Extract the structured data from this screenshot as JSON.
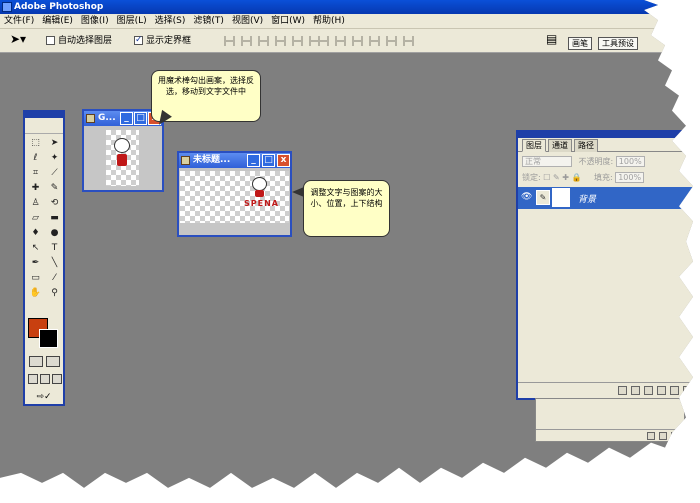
{
  "app": {
    "title": "Adobe Photoshop"
  },
  "menu": {
    "items": [
      "文件(F)",
      "编辑(E)",
      "图像(I)",
      "图层(L)",
      "选择(S)",
      "滤镜(T)",
      "视图(V)",
      "窗口(W)",
      "帮助(H)"
    ]
  },
  "options": {
    "tool_icon": "move-tool-icon",
    "auto_select_label": "自动选择图层",
    "auto_select_checked": false,
    "show_bounds_label": "显示定界框",
    "show_bounds_checked": true,
    "palette_tabs": [
      "画笔",
      "工具预设"
    ]
  },
  "toolbox": {
    "foreground_color": "#c84010",
    "background_color": "#000000"
  },
  "doc1": {
    "title": "G...",
    "buttons": [
      "_",
      "□",
      "x"
    ]
  },
  "doc2": {
    "title": "未标题...",
    "buttons": [
      "_",
      "□",
      "x"
    ],
    "text": "SPENA"
  },
  "callouts": {
    "first": "用魔术棒勾出画案，选择反选，移动到文字文件中",
    "second": "调整文字与图案的大小、位置，上下结构"
  },
  "layers_panel": {
    "tabs": [
      "图层",
      "通道",
      "路径"
    ],
    "blend_mode": "正常",
    "opacity_label": "不透明度:",
    "opacity_value": "100%",
    "lock_label": "锁定:",
    "fill_label": "填充:",
    "fill_value": "100%",
    "layer_name": "背景"
  },
  "colors": {
    "accent": "#1f3fa8",
    "selection": "#3166c6",
    "workspace": "#7f7f7f",
    "callout_bg": "#ffffc6"
  }
}
